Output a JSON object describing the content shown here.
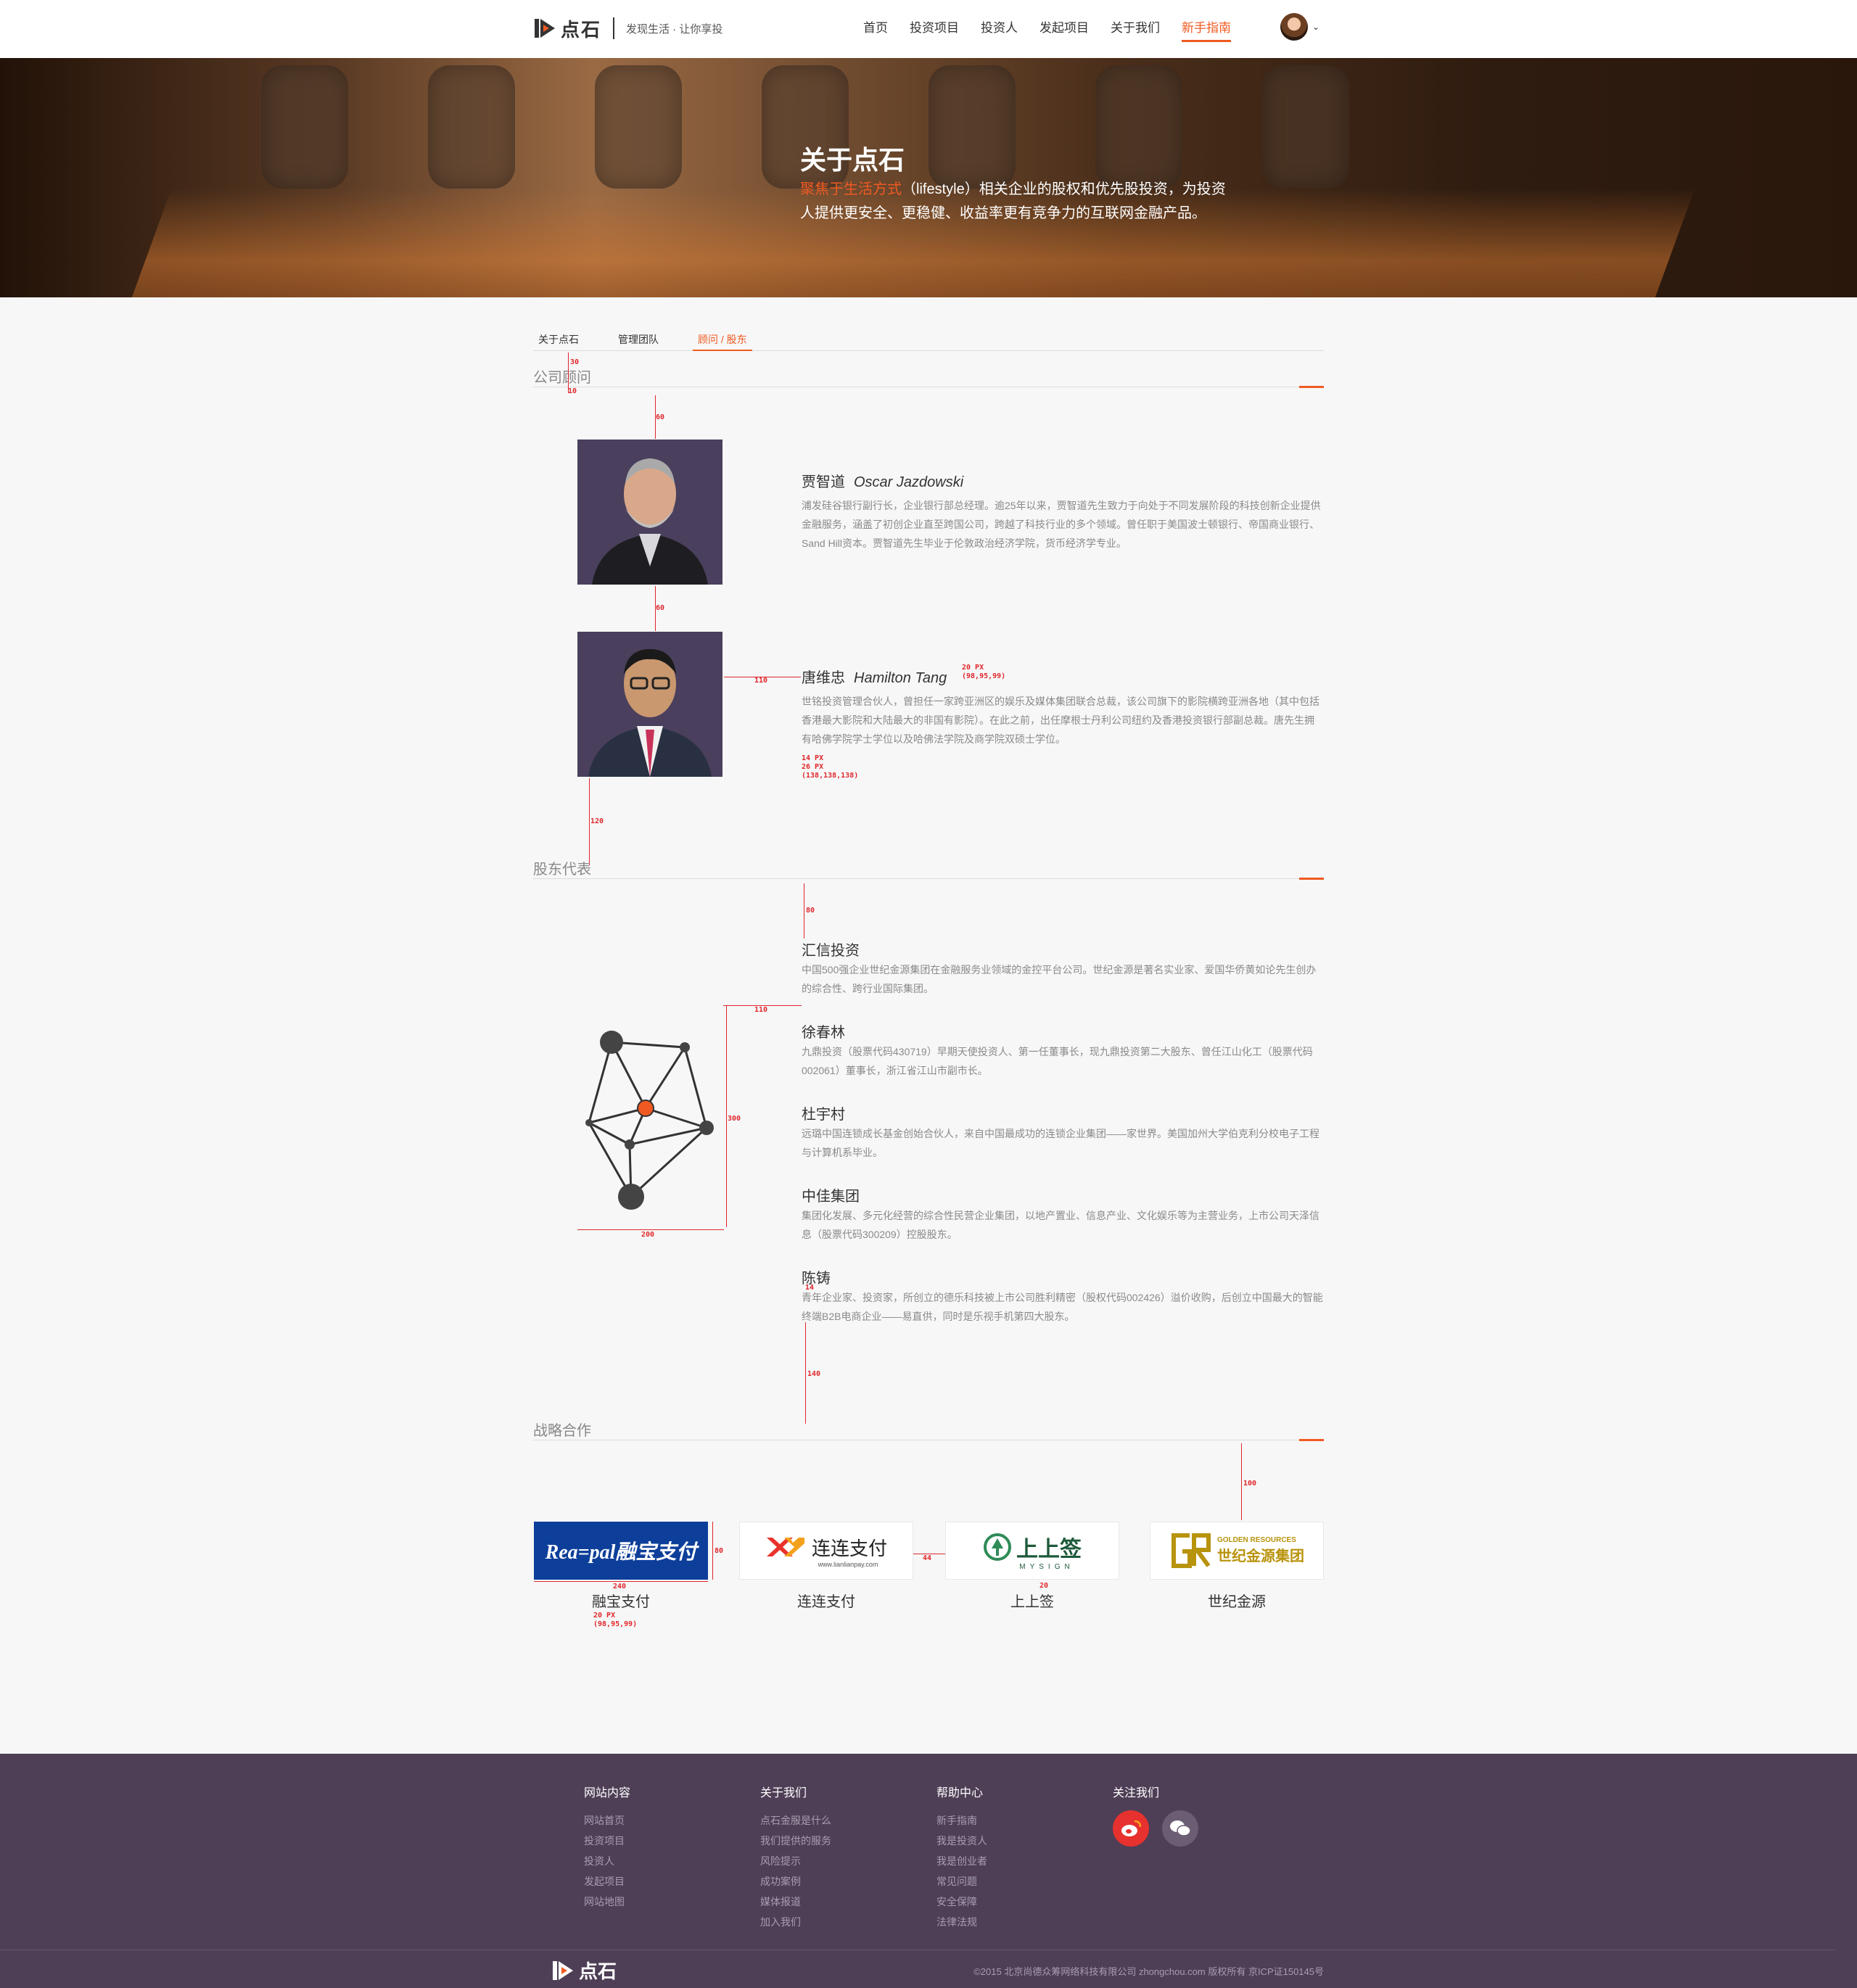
{
  "header": {
    "logo_text": "点石",
    "slogan": "发现生活 · 让你享投",
    "nav": [
      "首页",
      "投资项目",
      "投资人",
      "发起项目",
      "关于我们",
      "新手指南"
    ],
    "active_nav": "新手指南"
  },
  "banner": {
    "title": "关于点石",
    "desc_highlight": "聚焦于生活方式",
    "desc_rest": "（lifestyle）相关企业的股权和优先股投资，为投资人提供更安全、更稳健、收益率更有竞争力的互联网金融产品。"
  },
  "tabs": [
    "关于点石",
    "管理团队",
    "顾问 / 股东"
  ],
  "active_tab": "顾问 / 股东",
  "advisors": {
    "title": "公司顾问",
    "items": [
      {
        "name": "贾智道",
        "en": "Oscar Jazdowski",
        "desc": "浦发硅谷银行副行长，企业银行部总经理。逾25年以来，贾智道先生致力于向处于不同发展阶段的科技创新企业提供金融服务，涵盖了初创企业直至跨国公司，跨越了科技行业的多个领域。曾任职于美国波士顿银行、帝国商业银行、Sand Hill资本。贾智道先生毕业于伦敦政治经济学院，货币经济学专业。"
      },
      {
        "name": "唐维忠",
        "en": "Hamilton Tang",
        "desc": "世铭投资管理合伙人，曾担任一家跨亚洲区的娱乐及媒体集团联合总裁，该公司旗下的影院横跨亚洲各地（其中包括香港最大影院和大陆最大的非国有影院）。在此之前，出任摩根士丹利公司纽约及香港投资银行部副总裁。唐先生拥有哈佛学院学士学位以及哈佛法学院及商学院双硕士学位。"
      }
    ]
  },
  "shareholders": {
    "title": "股东代表",
    "items": [
      {
        "name": "汇信投资",
        "desc": "中国500强企业世纪金源集团在金融服务业领域的金控平台公司。世纪金源是著名实业家、爱国华侨黄如论先生创办的综合性、跨行业国际集团。"
      },
      {
        "name": "徐春林",
        "desc": "九鼎投资（股票代码430719）早期天使投资人、第一任董事长，现九鼎投资第二大股东、曾任江山化工（股票代码002061）董事长，浙江省江山市副市长。"
      },
      {
        "name": "杜宇村",
        "desc": "远璐中国连锁成长基金创始合伙人，来自中国最成功的连锁企业集团——家世界。美国加州大学伯克利分校电子工程与计算机系毕业。"
      },
      {
        "name": "中佳集团",
        "desc": "集团化发展、多元化经营的综合性民营企业集团，以地产置业、信息产业、文化娱乐等为主营业务，上市公司天泽信息（股票代码300209）控股股东。"
      },
      {
        "name": "陈铸",
        "desc": "青年企业家、投资家，所创立的德乐科技被上市公司胜利精密（股权代码002426）溢价收购，后创立中国最大的智能终端B2B电商企业——易直供，同时是乐视手机第四大股东。"
      }
    ]
  },
  "partners": {
    "title": "战略合作",
    "items": [
      {
        "label": "融宝支付",
        "logo": "Rea=pal融宝支付"
      },
      {
        "label": "连连支付",
        "logo": "连连支付",
        "sub": "www.lianlianpay.com"
      },
      {
        "label": "上上签",
        "logo": "上上签",
        "sub": "MYSIGN"
      },
      {
        "label": "世纪金源",
        "logo": "世纪金源集团",
        "sub": "GOLDEN RESOURCES"
      }
    ]
  },
  "annotations": {
    "a30": "30",
    "a10": "10",
    "a60a": "60",
    "a60b": "60",
    "a110a": "110",
    "a120": "120",
    "name_spec": "20 PX\n(98,95,99)",
    "desc_spec": "14 PX\n26 PX\n(138,138,138)",
    "a80a": "80",
    "a110b": "110",
    "a300": "300",
    "a200": "200",
    "a14": "14",
    "a140": "140",
    "a100": "100",
    "a80b": "80",
    "a240": "240",
    "a44": "44",
    "a20": "20",
    "partner_spec": "20 PX\n(98,95,99)"
  },
  "footer": {
    "cols": [
      {
        "title": "网站内容",
        "items": [
          "网站首页",
          "投资项目",
          "投资人",
          "发起项目",
          "网站地图"
        ]
      },
      {
        "title": "关于我们",
        "items": [
          "点石金服是什么",
          "我们提供的服务",
          "风险提示",
          "成功案例",
          "媒体报道",
          "加入我们"
        ]
      },
      {
        "title": "帮助中心",
        "items": [
          "新手指南",
          "我是投资人",
          "我是创业者",
          "常见问题",
          "安全保障",
          "法律法规"
        ]
      },
      {
        "title": "关注我们",
        "items": []
      }
    ],
    "logo_text": "点石",
    "copyright": "©2015 北京尚德众筹网络科技有限公司 zhongchou.com 版权所有 京ICP证150145号"
  },
  "colors": {
    "accent": "#f05a22",
    "footer_bg": "#4e3f56",
    "annotation": "#e0262b"
  }
}
